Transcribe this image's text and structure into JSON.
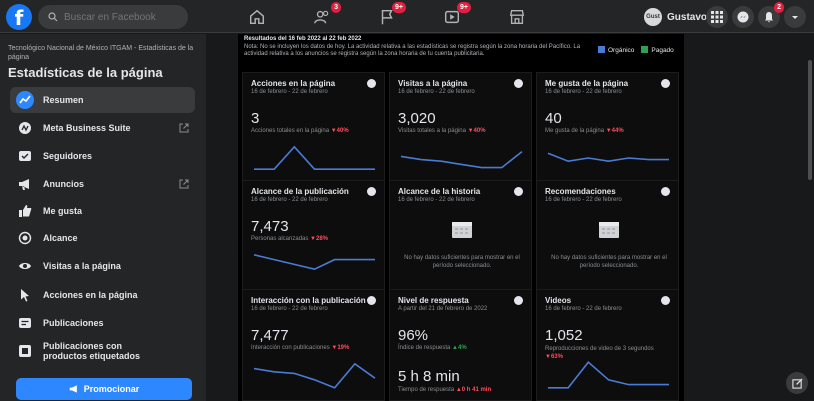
{
  "topbar": {
    "logo": "f",
    "search_placeholder": "Buscar en Facebook",
    "nav": [
      {
        "icon": "home-icon",
        "badge": ""
      },
      {
        "icon": "friends-icon",
        "badge": "3"
      },
      {
        "icon": "pages-flag-icon",
        "badge": "9+"
      },
      {
        "icon": "watch-icon",
        "badge": "9+"
      },
      {
        "icon": "marketplace-icon",
        "badge": ""
      }
    ],
    "profile_initials": "Gust",
    "profile_name": "Gustavo",
    "notifications_badge": "2"
  },
  "sidebar": {
    "breadcrumb": "Tecnológico Nacional de México ITGAM - Estadísticas de la página",
    "title": "Estadísticas de la página",
    "items": [
      {
        "label": "Resumen",
        "icon": "chart-trend-icon"
      },
      {
        "label": "Meta Business Suite",
        "icon": "meta-business-icon"
      },
      {
        "label": "Seguidores",
        "icon": "followers-icon"
      },
      {
        "label": "Anuncios",
        "icon": "megaphone-icon"
      },
      {
        "label": "Me gusta",
        "icon": "thumbs-up-icon"
      },
      {
        "label": "Alcance",
        "icon": "reach-icon"
      },
      {
        "label": "Visitas a la página",
        "icon": "eye-icon"
      },
      {
        "label": "Acciones en la página",
        "icon": "cursor-icon"
      },
      {
        "label": "Publicaciones",
        "icon": "posts-icon"
      },
      {
        "label": "Publicaciones con productos etiquetados",
        "icon": "tagged-products-icon"
      }
    ],
    "promote_label": "Promocionar"
  },
  "main": {
    "note_dates": "Resultados del 16 feb 2022 al 22 feb 2022",
    "note_text": "Nota: No se incluyen los datos de hoy. La actividad relativa a las estadísticas se registra según la zona horaria del Pacífico. La actividad relativa a los anuncios se registra según la zona horaria de tu cuenta publicitaria.",
    "legend_organic": "Orgánico",
    "legend_paid": "Pagado",
    "colors": {
      "organic": "#4a7bd4",
      "paid": "#31a24c",
      "down": "#ff4d5a",
      "up": "#31a24c"
    },
    "cards": [
      {
        "title": "Acciones en la página",
        "date": "16 de febrero - 22 de febrero",
        "value": "3",
        "sub": "Acciones totales en la página",
        "change": "▼40%",
        "trend": [
          0.15,
          0.15,
          0.85,
          0.15,
          0.15,
          0.15,
          0.15
        ]
      },
      {
        "title": "Visitas a la página",
        "date": "16 de febrero - 22 de febrero",
        "value": "3,020",
        "sub": "Visitas totales a la página",
        "change": "▼40%",
        "trend": [
          0.55,
          0.45,
          0.4,
          0.3,
          0.2,
          0.2,
          0.7
        ]
      },
      {
        "title": "Me gusta de la página",
        "date": "16 de febrero - 22 de febrero",
        "value": "40",
        "sub": "Me gusta de la página",
        "change": "▼44%",
        "trend": [
          0.65,
          0.4,
          0.5,
          0.4,
          0.5,
          0.45,
          0.45
        ]
      },
      {
        "title": "Alcance de la publicación",
        "date": "16 de febrero - 22 de febrero",
        "value": "7,473",
        "sub": "Personas alcanzadas",
        "change": "▼28%",
        "trend": [
          0.85,
          0.7,
          0.55,
          0.4,
          0.7,
          0.7,
          0.7
        ]
      },
      {
        "title": "Alcance de la historia",
        "date": "16 de febrero - 22 de febrero",
        "empty": "No hay datos suficientes para mostrar en el período seleccionado."
      },
      {
        "title": "Recomendaciones",
        "date": "16 de febrero - 22 de febrero",
        "empty": "No hay datos suficientes para mostrar en el período seleccionado."
      },
      {
        "title": "Interacción con la publicación",
        "date": "16 de febrero - 22 de febrero",
        "value": "7,477",
        "sub": "Interacción con publicaciones",
        "change": "▼19%",
        "trend": [
          0.7,
          0.6,
          0.55,
          0.35,
          0.1,
          0.85,
          0.4
        ]
      },
      {
        "title": "Nivel de respuesta",
        "date": "A partir del 21 de febrero de 2022",
        "value": "96%",
        "sub": "Índice de respuesta",
        "change": "▲4%",
        "change_up": true,
        "value2": "5 h 8 min",
        "sub2": "Tiempo de respuesta",
        "change2": "▲0 h 41 min"
      },
      {
        "title": "Videos",
        "date": "16 de febrero - 22 de febrero",
        "value": "1,052",
        "sub": "Reproducciones de video de 3 segundos",
        "change": "▼63%",
        "trend": [
          0.1,
          0.1,
          0.9,
          0.35,
          0.2,
          0.2,
          0.2
        ]
      }
    ]
  }
}
